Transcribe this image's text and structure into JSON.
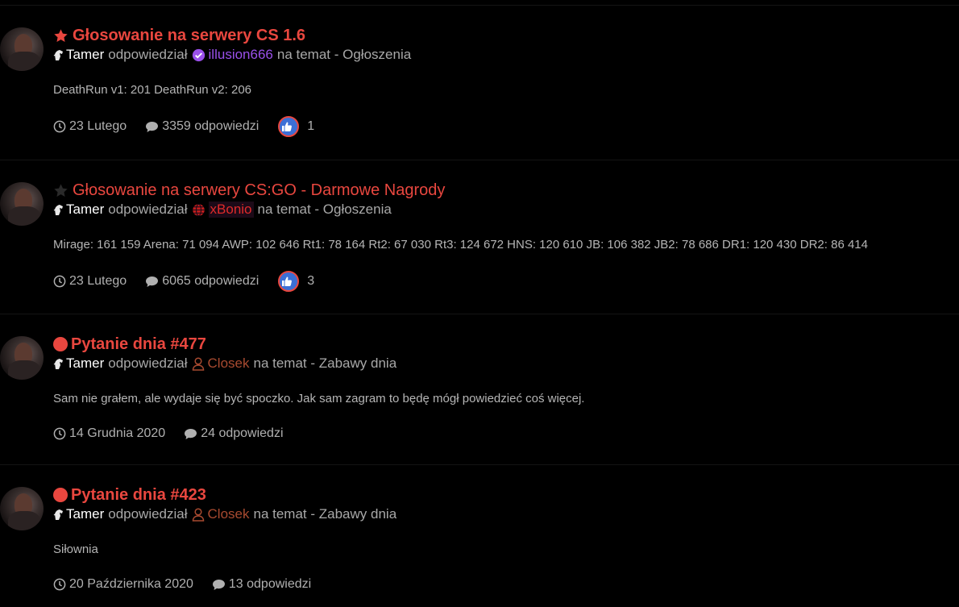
{
  "colors": {
    "accent": "#e9473f",
    "background": "#000000",
    "text_muted": "#a8a8a8",
    "user_purple": "#9a50ea",
    "user_red": "#e02a2a",
    "user_brown": "#a84a30",
    "like_blue": "#3b6fd6"
  },
  "feed": [
    {
      "title": "Głosowanie na serwery CS 1.6",
      "title_icon": "star-icon-red",
      "author": "Tamer",
      "verb": "odpowiedział",
      "target_user": "illusion666",
      "target_user_icon": "verified-badge-icon",
      "rest": "na temat - Ogłoszenia",
      "excerpt": "DeathRun v1: 201 DeathRun v2: 206",
      "date": "23 Lutego",
      "replies": "3359 odpowiedzi",
      "likes": "1"
    },
    {
      "title": "Głosowanie na serwery CS:GO - Darmowe Nagrody",
      "title_icon": "star-icon-dark",
      "author": "Tamer",
      "verb": "odpowiedział",
      "target_user": "xBonio",
      "target_user_icon": "globe-icon",
      "rest": "na temat - Ogłoszenia",
      "excerpt": "Mirage: 161 159 Arena: 71 094 AWP: 102 646 Rt1: 78 164 Rt2: 67 030 Rt3: 124 672 HNS: 120 610 JB: 106 382 JB2: 78 686 DR1: 120 430 DR2: 86 414",
      "date": "23 Lutego",
      "replies": "6065 odpowiedzi",
      "likes": "3"
    },
    {
      "title": "Pytanie dnia #477",
      "title_icon": "red-dot-icon",
      "author": "Tamer",
      "verb": "odpowiedział",
      "target_user": "Closek",
      "target_user_icon": "user-outline-icon",
      "rest": "na temat - Zabawy dnia",
      "excerpt": "Sam nie grałem, ale wydaje się być spoczko. Jak sam zagram to będę mógł powiedzieć coś więcej.",
      "date": "14 Grudnia 2020",
      "replies": "24 odpowiedzi"
    },
    {
      "title": "Pytanie dnia #423",
      "title_icon": "red-dot-icon",
      "author": "Tamer",
      "verb": "odpowiedział",
      "target_user": "Closek",
      "target_user_icon": "user-outline-icon",
      "rest": "na temat - Zabawy dnia",
      "excerpt": "Siłownia",
      "date": "20 Października 2020",
      "replies": "13 odpowiedzi"
    }
  ]
}
